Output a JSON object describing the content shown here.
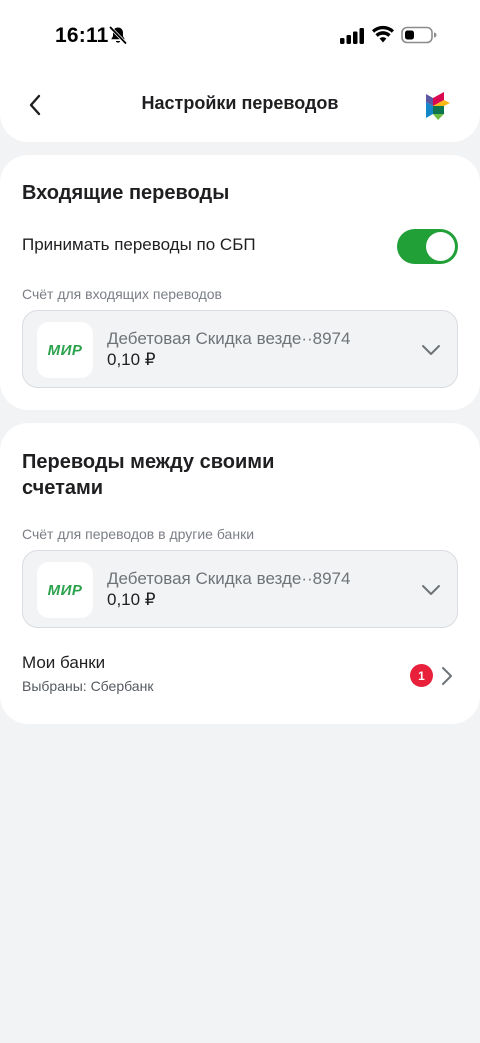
{
  "status_bar": {
    "time": "16:11",
    "icons": [
      "bell-off-icon",
      "signal-icon",
      "wifi-icon",
      "battery-icon"
    ]
  },
  "header": {
    "title": "Настройки переводов",
    "back_icon": "chevron-left-icon",
    "logo_icon": "sbp-logo-icon"
  },
  "incoming": {
    "title": "Входящие переводы",
    "toggle_label": "Принимать переводы по СБП",
    "toggle_on": true,
    "account_label": "Счёт для входящих переводов",
    "account": {
      "card_system": "МИР",
      "name": "Дебетовая Скидка везде··8974",
      "balance": "0,10 ₽"
    }
  },
  "between": {
    "title_line1": "Переводы между своими",
    "title_line2": "счетами",
    "account_label": "Счёт для переводов в другие банки",
    "account": {
      "card_system": "МИР",
      "name": "Дебетовая Скидка везде··8974",
      "balance": "0,10 ₽"
    },
    "banks": {
      "title": "Мои банки",
      "subtitle": "Выбраны: Сбербанк",
      "badge_count": "1"
    }
  },
  "colors": {
    "accent_green": "#21A038",
    "mir_green": "#2CA24D",
    "badge_red": "#E8203A",
    "background": "#F2F3F5"
  }
}
